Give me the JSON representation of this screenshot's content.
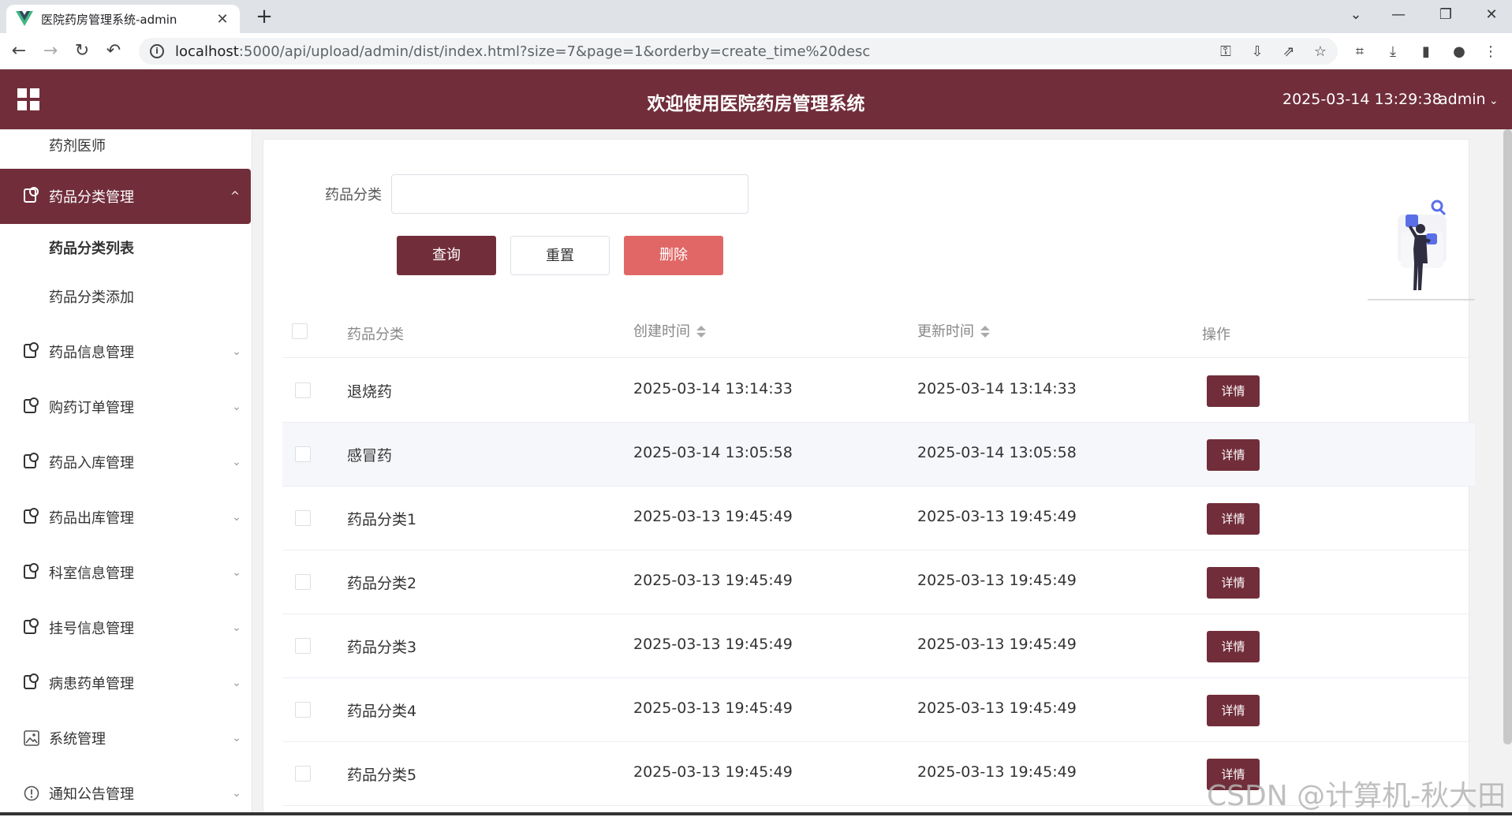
{
  "browser": {
    "tab_title": "医院药房管理系统-admin",
    "url_host": "localhost",
    "url_rest": ":5000/api/upload/admin/dist/index.html?size=7&page=1&orderby=create_time%20desc",
    "icons": [
      "back-icon",
      "forward-icon",
      "reload-icon",
      "undo-icon",
      "info-icon",
      "key-icon",
      "install-icon",
      "share-icon",
      "star-icon",
      "crop-icon",
      "download-icon",
      "sidepanel-icon",
      "profile-icon",
      "menu-icon"
    ]
  },
  "header": {
    "title": "欢迎使用医院药房管理系统",
    "time": "2025-03-14 13:29:38",
    "user": "admin",
    "bg_color": "#712e3a"
  },
  "sidebar": {
    "top_item": "药剂医师",
    "active_group": {
      "label": "药品分类管理",
      "chev": "^"
    },
    "sub_items": [
      {
        "label": "药品分类列表",
        "active": true
      },
      {
        "label": "药品分类添加",
        "active": false
      }
    ],
    "groups": [
      {
        "label": "药品信息管理",
        "icon": "doc-icon"
      },
      {
        "label": "购药订单管理",
        "icon": "doc-icon"
      },
      {
        "label": "药品入库管理",
        "icon": "doc-icon"
      },
      {
        "label": "药品出库管理",
        "icon": "doc-icon"
      },
      {
        "label": "科室信息管理",
        "icon": "doc-icon"
      },
      {
        "label": "挂号信息管理",
        "icon": "doc-icon"
      },
      {
        "label": "病患药单管理",
        "icon": "doc-icon"
      },
      {
        "label": "系统管理",
        "icon": "image-icon"
      },
      {
        "label": "通知公告管理",
        "icon": "alert-icon"
      }
    ],
    "chev_down": "⌄"
  },
  "search": {
    "label": "药品分类",
    "value": "",
    "query_btn": "查询",
    "reset_btn": "重置",
    "delete_btn": "删除"
  },
  "table": {
    "headers": {
      "category": "药品分类",
      "created": "创建时间",
      "updated": "更新时间",
      "action": "操作"
    },
    "detail_label": "详情",
    "rows": [
      {
        "category": "退烧药",
        "created": "2025-03-14 13:14:33",
        "updated": "2025-03-14 13:14:33"
      },
      {
        "category": "感冒药",
        "created": "2025-03-14 13:05:58",
        "updated": "2025-03-14 13:05:58"
      },
      {
        "category": "药品分类1",
        "created": "2025-03-13 19:45:49",
        "updated": "2025-03-13 19:45:49"
      },
      {
        "category": "药品分类2",
        "created": "2025-03-13 19:45:49",
        "updated": "2025-03-13 19:45:49"
      },
      {
        "category": "药品分类3",
        "created": "2025-03-13 19:45:49",
        "updated": "2025-03-13 19:45:49"
      },
      {
        "category": "药品分类4",
        "created": "2025-03-13 19:45:49",
        "updated": "2025-03-13 19:45:49"
      },
      {
        "category": "药品分类5",
        "created": "2025-03-13 19:45:49",
        "updated": "2025-03-13 19:45:49"
      }
    ]
  },
  "watermark": "CSDN @计算机-秋大田"
}
